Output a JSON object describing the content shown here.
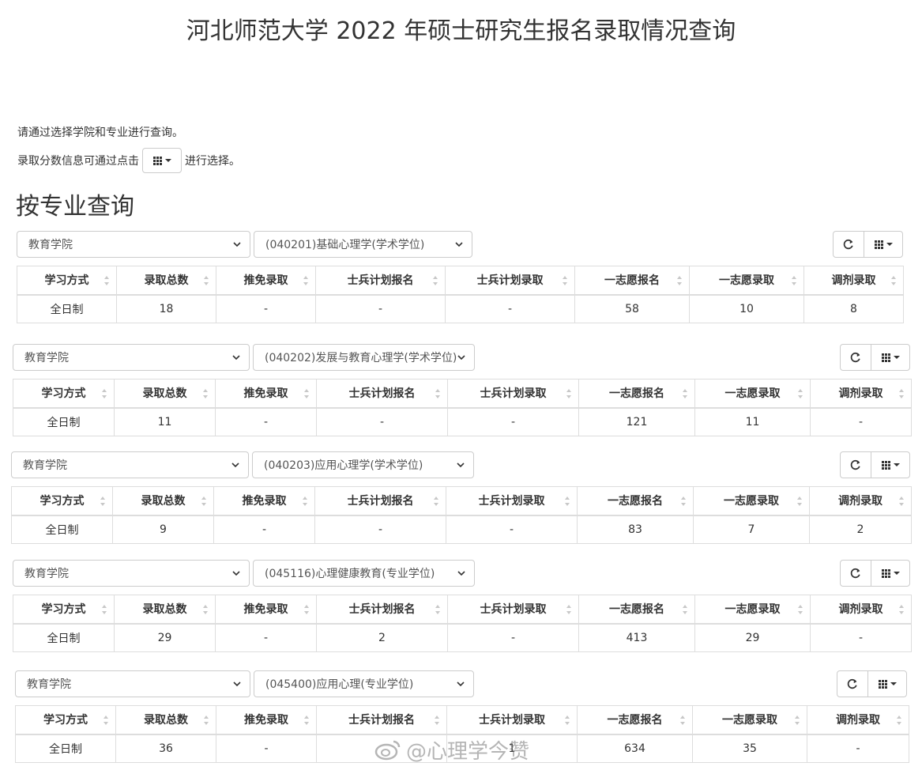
{
  "title": "河北师范大学 2022 年硕士研究生报名录取情况查询",
  "intro": {
    "line1": "请通过选择学院和专业进行查询。",
    "line2_before": "录取分数信息可通过点击",
    "line2_after": "进行选择。"
  },
  "section_heading": "按专业查询",
  "columns": [
    "学习方式",
    "录取总数",
    "推免录取",
    "士兵计划报名",
    "士兵计划录取",
    "一志愿报名",
    "一志愿录取",
    "调剂录取"
  ],
  "blocks": [
    {
      "college": "教育学院",
      "major": "(040201)基础心理学(学术学位)",
      "row": [
        "全日制",
        "18",
        "-",
        "-",
        "-",
        "58",
        "10",
        "8"
      ]
    },
    {
      "college": "教育学院",
      "major": "(040202)发展与教育心理学(学术学位)",
      "row": [
        "全日制",
        "11",
        "-",
        "-",
        "-",
        "121",
        "11",
        "-"
      ]
    },
    {
      "college": "教育学院",
      "major": "(040203)应用心理学(学术学位)",
      "row": [
        "全日制",
        "9",
        "-",
        "-",
        "-",
        "83",
        "7",
        "2"
      ]
    },
    {
      "college": "教育学院",
      "major": "(045116)心理健康教育(专业学位)",
      "row": [
        "全日制",
        "29",
        "-",
        "2",
        "-",
        "413",
        "29",
        "-"
      ]
    },
    {
      "college": "教育学院",
      "major": "(045400)应用心理(专业学位)",
      "row": [
        "全日制",
        "36",
        "-",
        "",
        "1",
        "634",
        "35",
        "-"
      ]
    }
  ],
  "watermark": "@心理学今赞",
  "icons": {
    "refresh": "refresh-icon",
    "columns": "columns-grid-icon",
    "select": "chevron-down-icon",
    "sort": "sort-both-icon"
  }
}
